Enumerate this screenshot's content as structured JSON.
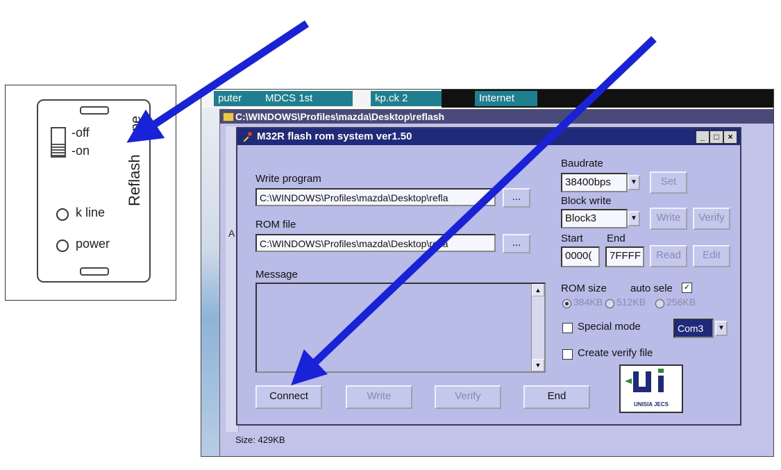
{
  "hardware": {
    "off_label": "-off",
    "on_label": "-on",
    "reflash_label": "Reflash",
    "type_fragment": "pe",
    "kline_label": "k line",
    "power_label": "power"
  },
  "taskbar": {
    "tabs": [
      {
        "label": "puter",
        "color": "#1f7f8f"
      },
      {
        "label": "MDCS 1st",
        "color": "#1f7f8f"
      },
      {
        "label": "kp.ck 2",
        "color": "#1f7f8f"
      },
      {
        "label": "Internet",
        "color": "#1f7f8f"
      }
    ]
  },
  "profiles_window": {
    "title": "C:\\WINDOWS\\Profiles\\mazda\\Desktop\\reflash",
    "status": "Size: 429KB",
    "side_letter": "A"
  },
  "dialog": {
    "title": "M32R flash rom system ver1.50",
    "write_program": {
      "label": "Write program",
      "value": "C:\\WINDOWS\\Profiles\\mazda\\Desktop\\refla",
      "browse": "..."
    },
    "rom_file": {
      "label": "ROM file",
      "value": "C:\\WINDOWS\\Profiles\\mazda\\Desktop\\refla",
      "browse": "..."
    },
    "message_label": "Message",
    "baudrate": {
      "label": "Baudrate",
      "value": "38400bps",
      "set": "Set"
    },
    "block_write": {
      "label": "Block write",
      "value": "Block3",
      "write": "Write",
      "verify": "Verify"
    },
    "start": {
      "label": "Start",
      "value": "0000("
    },
    "end": {
      "label": "End",
      "value": "7FFFF"
    },
    "read": "Read",
    "edit": "Edit",
    "rom_size": {
      "label": "ROM size",
      "auto_select": "auto sele",
      "auto_checked": true,
      "options": [
        "384KB",
        "512KB",
        "256KB"
      ],
      "selected": 0
    },
    "special_mode": {
      "label": "Special mode",
      "checked": false,
      "port": "Com3"
    },
    "create_verify": {
      "label": "Create verify file",
      "checked": false
    },
    "buttons": {
      "connect": "Connect",
      "write": "Write",
      "verify": "Verify",
      "end": "End"
    },
    "logo_text": "UNISIA JECS"
  }
}
